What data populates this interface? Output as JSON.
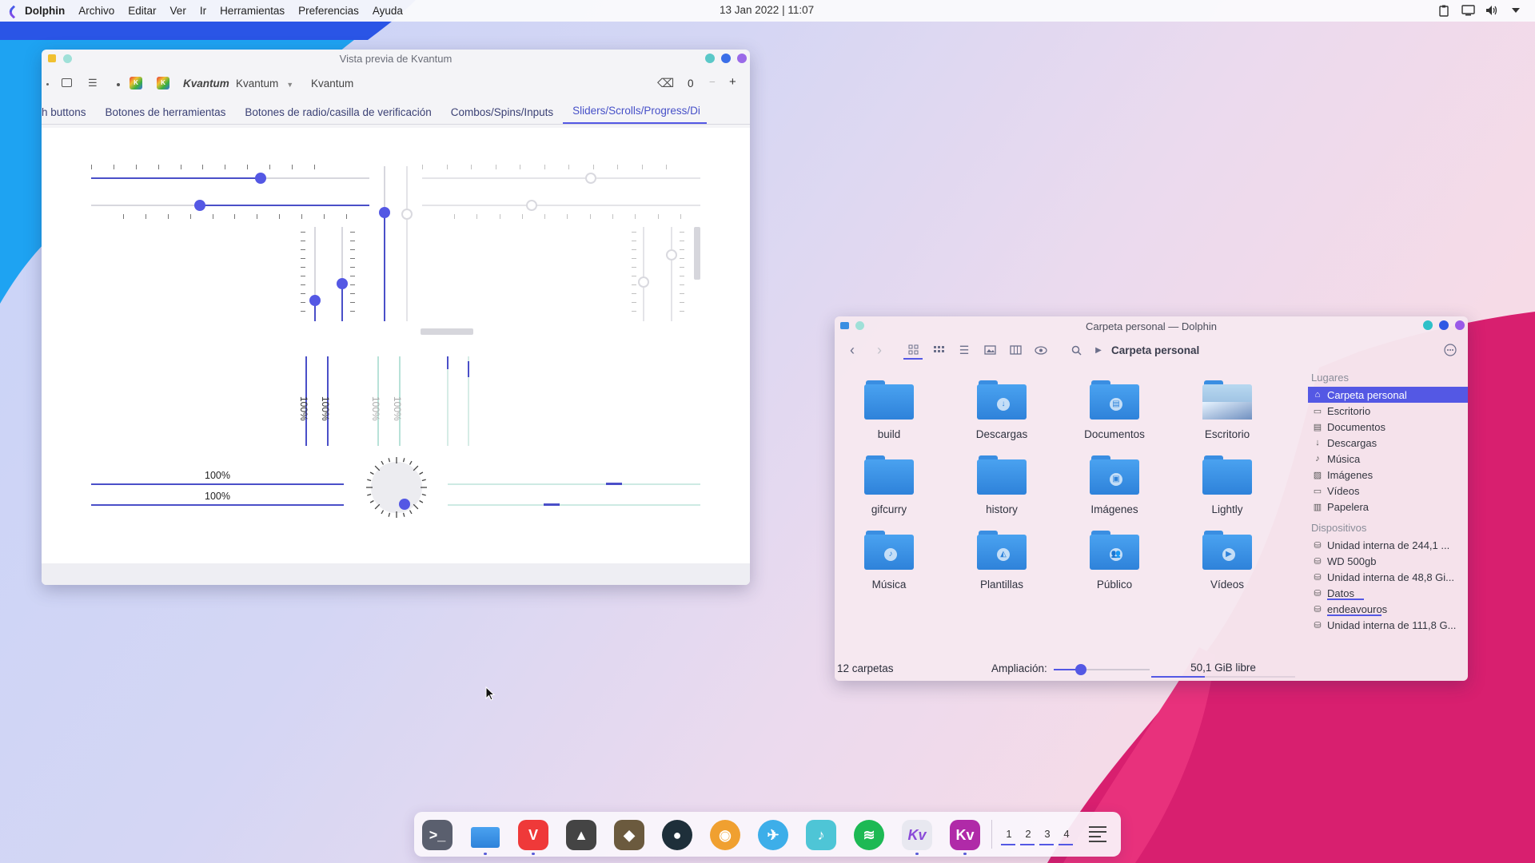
{
  "topbar": {
    "menu": [
      "Dolphin",
      "Archivo",
      "Editar",
      "Ver",
      "Ir",
      "Herramientas",
      "Preferencias",
      "Ayuda"
    ],
    "clock": "13 Jan 2022 | 11:07",
    "tray_icons": [
      "clipboard-icon",
      "display-icon",
      "volume-icon",
      "chevron-down-icon"
    ]
  },
  "kvantum": {
    "title": "Vista previa de Kvantum",
    "toolbar": {
      "italic_label": "Kvantum",
      "combo_value": "Kvantum",
      "text_label": "Kvantum",
      "spin_value": "0",
      "minus": "−",
      "plus": "+"
    },
    "tabs": [
      "h buttons",
      "Botones de herramientas",
      "Botones de radio/casilla de verificación",
      "Combos/Spins/Inputs",
      "Sliders/Scrolls/Progress/Di"
    ],
    "active_tab_index": 4,
    "progress": {
      "horizontal_labels": [
        "100%",
        "100%"
      ],
      "vertical_labels": [
        "100%",
        "100%",
        "100%",
        "100%"
      ],
      "horizontal_value": 1.0
    },
    "sliders": {
      "h1_value": 0.61,
      "h2_value": 0.39,
      "v_values": [
        0.22,
        0.4,
        0.7
      ],
      "dial_value": 0.5
    }
  },
  "dolphin": {
    "title": "Carpeta personal — Dolphin",
    "breadcrumb": "Carpeta personal",
    "folders": [
      {
        "name": "build",
        "emblem": ""
      },
      {
        "name": "Descargas",
        "emblem": "download"
      },
      {
        "name": "Documentos",
        "emblem": "document"
      },
      {
        "name": "Escritorio",
        "emblem": "desktop"
      },
      {
        "name": "gifcurry",
        "emblem": ""
      },
      {
        "name": "history",
        "emblem": ""
      },
      {
        "name": "Imágenes",
        "emblem": "image"
      },
      {
        "name": "Lightly",
        "emblem": ""
      },
      {
        "name": "Música",
        "emblem": "music"
      },
      {
        "name": "Plantillas",
        "emblem": "template"
      },
      {
        "name": "Público",
        "emblem": "users"
      },
      {
        "name": "Vídeos",
        "emblem": "video"
      }
    ],
    "places_header": "Lugares",
    "places": [
      {
        "label": "Carpeta personal",
        "icon": "home-icon",
        "selected": true
      },
      {
        "label": "Escritorio",
        "icon": "desktop-icon"
      },
      {
        "label": "Documentos",
        "icon": "document-icon"
      },
      {
        "label": "Descargas",
        "icon": "download-icon"
      },
      {
        "label": "Música",
        "icon": "music-icon"
      },
      {
        "label": "Imágenes",
        "icon": "image-icon"
      },
      {
        "label": "Vídeos",
        "icon": "video-icon"
      },
      {
        "label": "Papelera",
        "icon": "trash-icon"
      }
    ],
    "devices_header": "Dispositivos",
    "devices": [
      {
        "label": "Unidad interna de 244,1 ...",
        "usage": 0
      },
      {
        "label": "WD 500gb",
        "usage": 0
      },
      {
        "label": "Unidad interna de 48,8 Gi...",
        "usage": 0
      },
      {
        "label": "Datos",
        "usage": 0.27
      },
      {
        "label": "endeavouros",
        "usage": 0.4
      },
      {
        "label": "Unidad interna de 111,8 G...",
        "usage": 0
      }
    ],
    "status": {
      "count": "12 carpetas",
      "zoom_label": "Ampliación:",
      "zoom_value": 0.28,
      "free": "50,1 GiB libre",
      "usage": 0.37
    }
  },
  "dock": {
    "apps": [
      {
        "name": "terminal",
        "glyph": ">_",
        "color": "#5a5f6e",
        "running": false
      },
      {
        "name": "dolphin",
        "glyph": "",
        "color": "#3a8ee2",
        "running": true
      },
      {
        "name": "vivaldi",
        "glyph": "V",
        "color": "#ef3939",
        "running": true
      },
      {
        "name": "inkscape",
        "glyph": "▲",
        "color": "#444",
        "running": false
      },
      {
        "name": "gimp",
        "glyph": "◆",
        "color": "#6b5a3e",
        "running": false
      },
      {
        "name": "eclipse",
        "glyph": "●",
        "color": "#1e2f3a",
        "running": false
      },
      {
        "name": "color-picker",
        "glyph": "◉",
        "color": "#f0a030",
        "running": false
      },
      {
        "name": "kdeconnect",
        "glyph": "✈",
        "color": "#3daee9",
        "running": false
      },
      {
        "name": "music",
        "glyph": "♪",
        "color": "#4ec5d6",
        "running": false
      },
      {
        "name": "spotify",
        "glyph": "≋",
        "color": "#1db954",
        "running": false
      },
      {
        "name": "kvantum-manager",
        "glyph": "Kv",
        "color": "#e8e8f0",
        "running": true
      },
      {
        "name": "kvantum-preview",
        "glyph": "Kv",
        "color": "#b02aa8",
        "running": true
      }
    ],
    "desktops": [
      "1",
      "2",
      "3",
      "4"
    ]
  }
}
